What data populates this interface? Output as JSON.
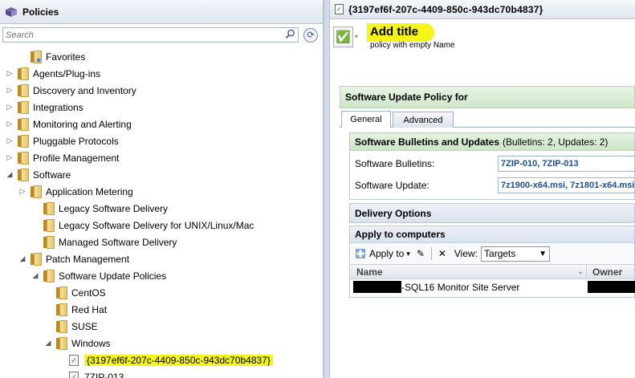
{
  "left_panel": {
    "title": "Policies",
    "search_placeholder": "Search",
    "tree": [
      {
        "label": "Favorites",
        "expander": "",
        "icon": "favorites-folder-icon"
      },
      {
        "label": "Agents/Plug-ins",
        "expander": "▷",
        "icon": "folder-icon"
      },
      {
        "label": "Discovery and Inventory",
        "expander": "▷",
        "icon": "folder-icon"
      },
      {
        "label": "Integrations",
        "expander": "▷",
        "icon": "folder-icon"
      },
      {
        "label": "Monitoring and Alerting",
        "expander": "▷",
        "icon": "folder-icon"
      },
      {
        "label": "Pluggable Protocols",
        "expander": "▷",
        "icon": "folder-icon"
      },
      {
        "label": "Profile Management",
        "expander": "▷",
        "icon": "folder-icon"
      },
      {
        "label": "Software",
        "expander": "◢",
        "icon": "folder-icon"
      },
      {
        "label": "Application Metering",
        "expander": "▷",
        "icon": "folder-icon"
      },
      {
        "label": "Legacy Software Delivery",
        "expander": "",
        "icon": "folder-icon"
      },
      {
        "label": "Legacy Software Delivery for UNIX/Linux/Mac",
        "expander": "",
        "icon": "folder-icon"
      },
      {
        "label": "Managed Software Delivery",
        "expander": "",
        "icon": "folder-icon"
      },
      {
        "label": "Patch Management",
        "expander": "◢",
        "icon": "folder-icon"
      },
      {
        "label": "Software Update Policies",
        "expander": "◢",
        "icon": "folder-icon"
      },
      {
        "label": "CentOS",
        "expander": "",
        "icon": "folder-icon"
      },
      {
        "label": "Red Hat",
        "expander": "",
        "icon": "folder-icon"
      },
      {
        "label": "SUSE",
        "expander": "",
        "icon": "folder-icon"
      },
      {
        "label": "Windows",
        "expander": "◢",
        "icon": "folder-icon"
      },
      {
        "label": "{3197ef6f-207c-4409-850c-943dc70b4837}",
        "expander": "",
        "icon": "policy-icon"
      },
      {
        "label": "7ZIP-013",
        "expander": "",
        "icon": "policy-icon"
      }
    ]
  },
  "right_panel": {
    "header_title": "{3197ef6f-207c-4409-850c-943dc70b4837}",
    "add_title": "Add title",
    "subtitle": "policy with empty Name",
    "section_title": "Software Update Policy for",
    "tabs": [
      "General",
      "Advanced"
    ],
    "bulletins": {
      "title_bold": "Software Bulletins and Updates",
      "title_counts": "(Bulletins: 2, Updates: 2)",
      "bulletins_label": "Software Bulletins:",
      "bulletins_value": "7ZIP-010, 7ZIP-013",
      "update_label": "Software Update:",
      "update_value": "7z1900-x64.msi, 7z1801-x64.msi"
    },
    "delivery_title": "Delivery Options",
    "apply": {
      "title": "Apply to computers",
      "apply_button": "Apply to",
      "view_label": "View:",
      "view_value": "Targets",
      "columns": [
        "Name",
        "Owner"
      ],
      "row_name_suffix": "-SQL16 Monitor Site Server"
    }
  },
  "colors": {
    "highlight": "#f5f51a",
    "link_blue": "#1c4f8e",
    "section_green": "#cfe6c9"
  }
}
